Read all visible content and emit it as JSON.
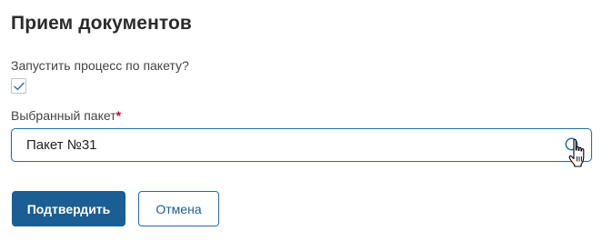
{
  "dialog": {
    "title": "Прием документов"
  },
  "form": {
    "process_label": "Запустить процесс по пакету?",
    "process_checked": true,
    "package_label": "Выбранный пакет",
    "package_required_mark": "*",
    "package_value": "Пакет №31"
  },
  "icons": {
    "checkbox": "check-icon",
    "search": "search-icon",
    "cursor": "hand-cursor-icon"
  },
  "actions": {
    "confirm_label": "Подтвердить",
    "cancel_label": "Отмена"
  },
  "colors": {
    "accent": "#1b5e94",
    "required": "#d0021b",
    "border_focus": "#1f6fa8"
  }
}
